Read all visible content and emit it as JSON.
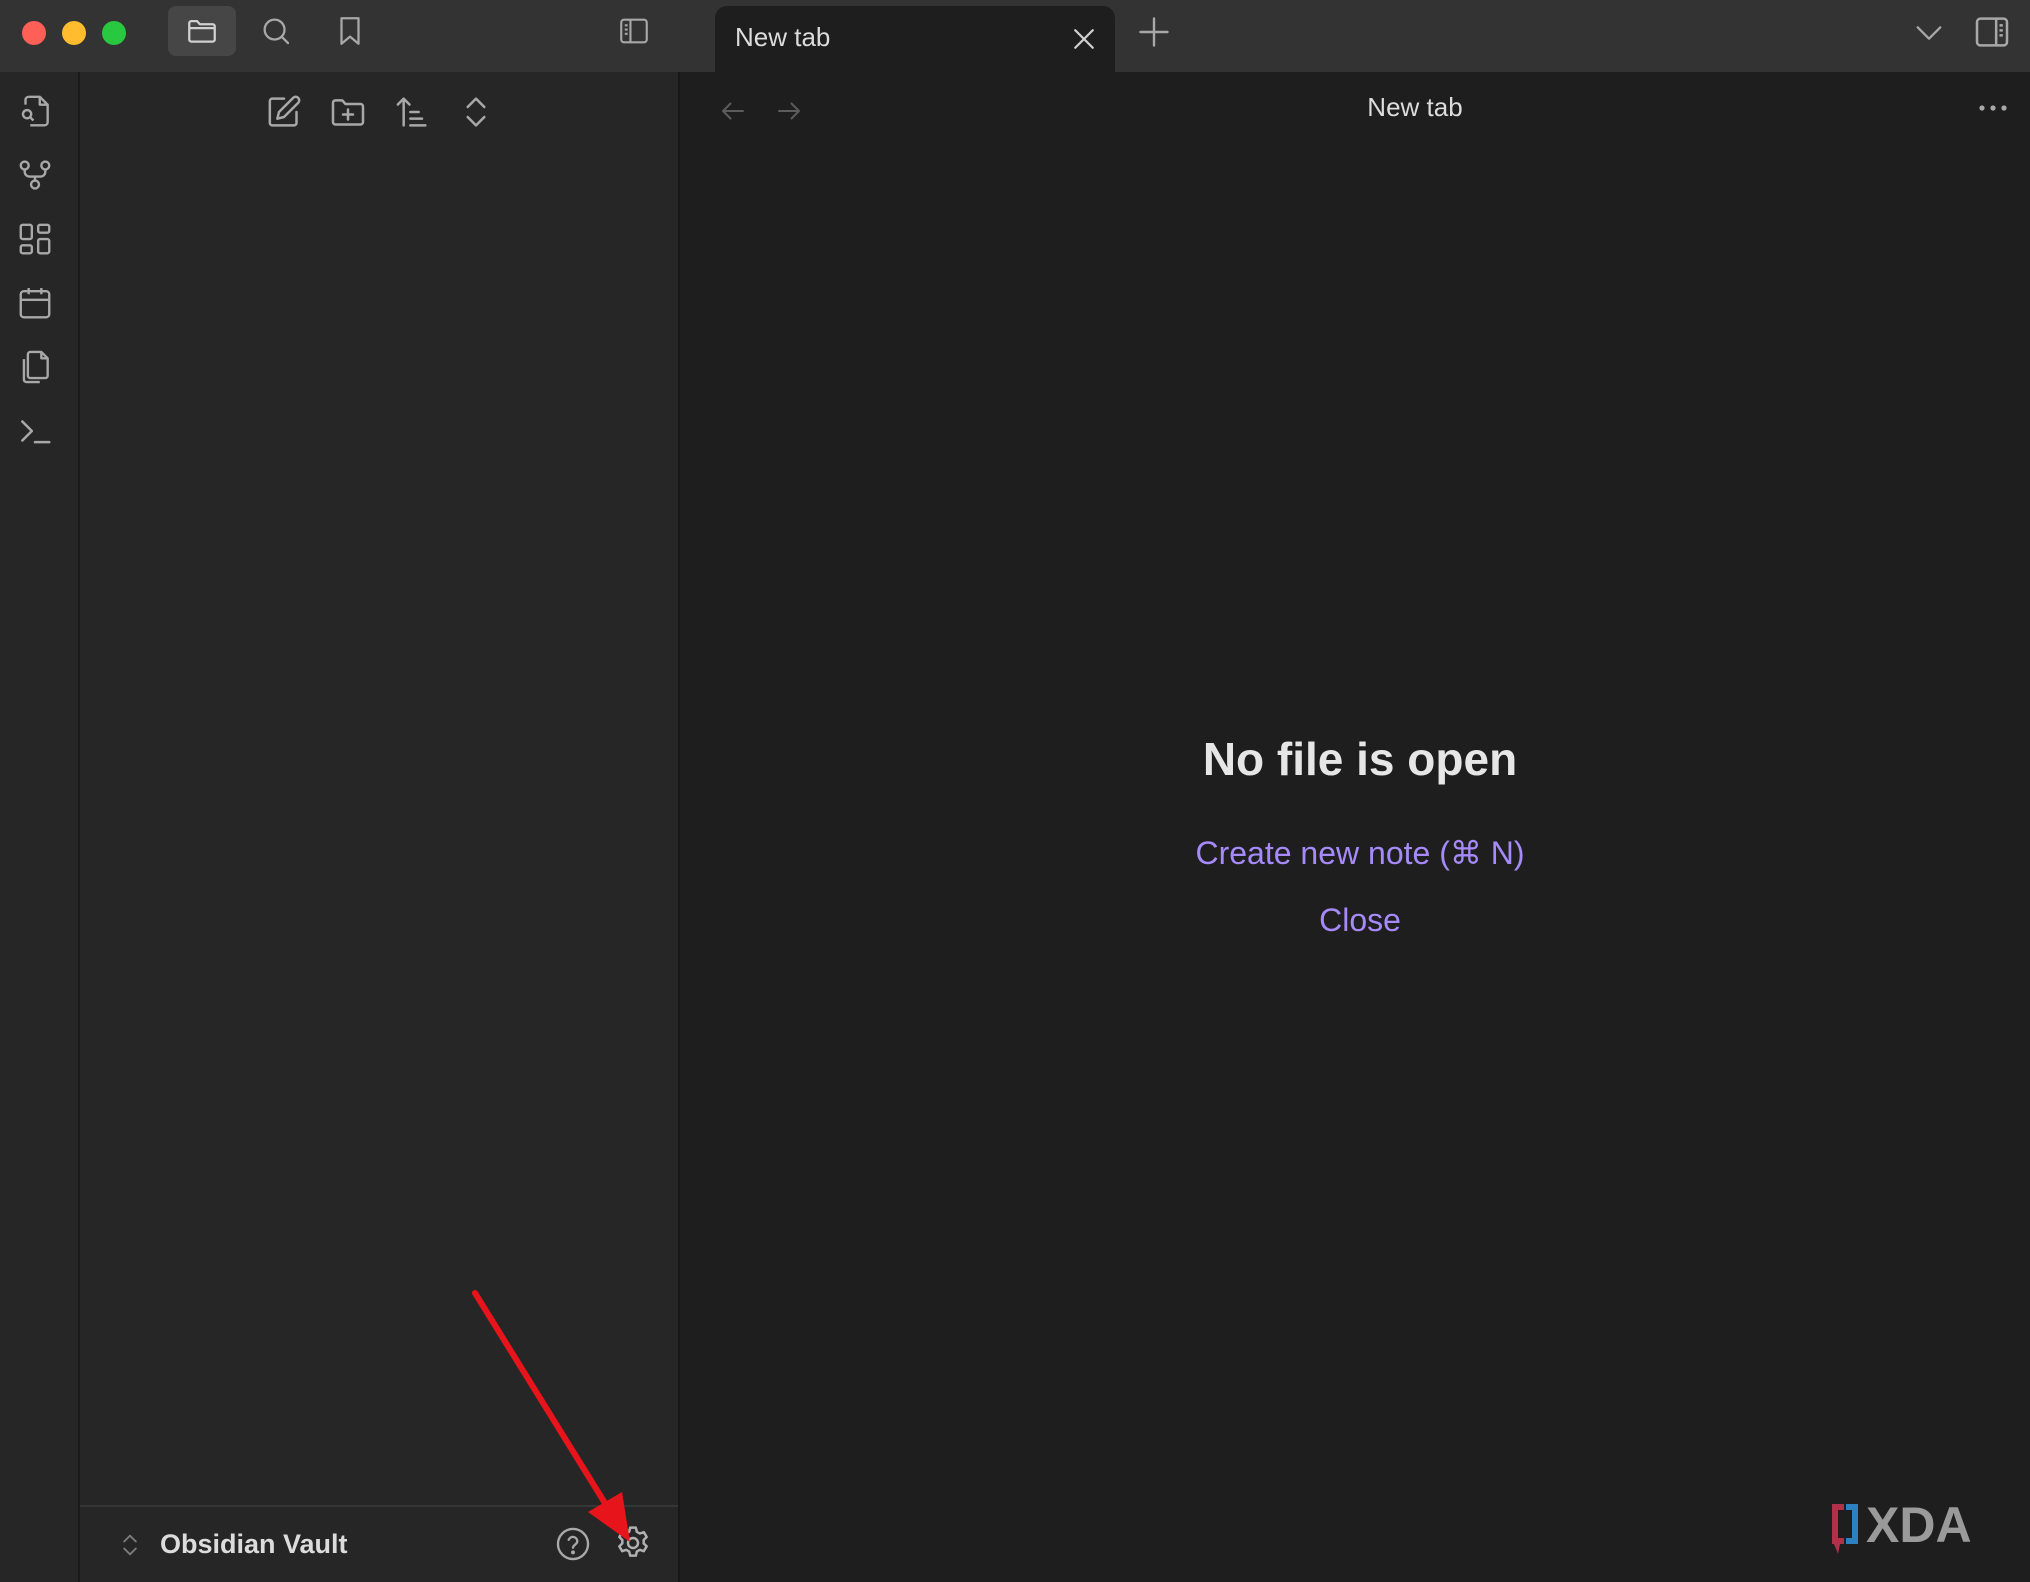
{
  "app": "Obsidian",
  "titlebar": {
    "window_controls": [
      "close",
      "minimize",
      "zoom"
    ],
    "left_buttons": [
      {
        "name": "files-icon",
        "label": "Files",
        "active": true
      },
      {
        "name": "search-icon",
        "label": "Search",
        "active": false
      },
      {
        "name": "bookmark-icon",
        "label": "Bookmarks",
        "active": false
      }
    ],
    "tabs": [
      {
        "label": "New tab",
        "active": true
      }
    ],
    "new_tab_icon": "plus-icon",
    "tab_list_icon": "chevron-down-icon"
  },
  "ribbon": {
    "items": [
      {
        "name": "open-quick-switcher-icon",
        "label": "Open quick switcher"
      },
      {
        "name": "graph-view-icon",
        "label": "Open graph view"
      },
      {
        "name": "canvas-icon",
        "label": "Create new canvas"
      },
      {
        "name": "daily-note-icon",
        "label": "Open today's daily note"
      },
      {
        "name": "templates-icon",
        "label": "Insert template"
      },
      {
        "name": "command-palette-icon",
        "label": "Open command palette"
      }
    ]
  },
  "sidebar": {
    "toolbar": [
      {
        "name": "new-note-icon",
        "label": "New note"
      },
      {
        "name": "new-folder-icon",
        "label": "New folder"
      },
      {
        "name": "sort-icon",
        "label": "Change sort order"
      },
      {
        "name": "expand-collapse-icon",
        "label": "Expand all"
      }
    ],
    "vault_name": "Obsidian Vault"
  },
  "main": {
    "view_title": "New tab",
    "empty_state": {
      "title": "No file is open",
      "create_label": "Create new note (⌘ N)",
      "close_label": "Close"
    }
  },
  "colors": {
    "accent": "#a68af9",
    "annotation_arrow": "#e8141b"
  },
  "watermark": "XDA"
}
